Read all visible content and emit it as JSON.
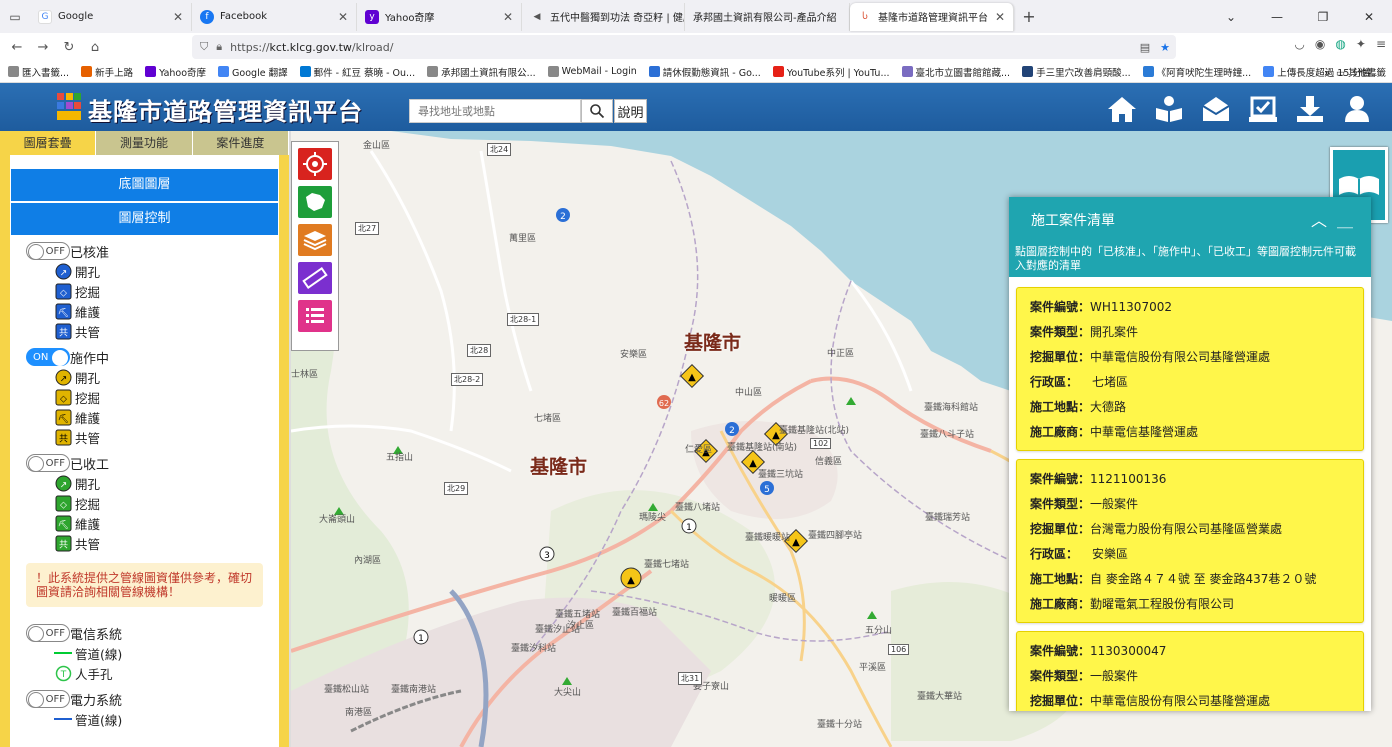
{
  "browser": {
    "tabs": [
      {
        "label": "Google",
        "color": "#4285f4",
        "glyph": "G"
      },
      {
        "label": "Facebook",
        "color": "#1877f2",
        "glyph": "f"
      },
      {
        "label": "Yahoo奇摩",
        "color": "#6001d2",
        "glyph": "y"
      },
      {
        "label": "五代中醫獨到功法 奇亞籽 | 健康",
        "color": "#777777",
        "glyph": "◀"
      },
      {
        "label": "承邦國土資訊有限公司-產品介紹",
        "color": "#cccccc",
        "glyph": ""
      },
      {
        "label": "基隆市道路管理資訊平台",
        "color": "#d94a2b",
        "glyph": "K"
      }
    ],
    "url_prefix": "https://",
    "url_host": "kct.klcg.gov.tw",
    "url_path": "/klroad/",
    "bookmarks": [
      {
        "label": "匯入書籤...",
        "color": "#888888"
      },
      {
        "label": "新手上路",
        "color": "#e66000"
      },
      {
        "label": "Yahoo奇摩",
        "color": "#6001d2"
      },
      {
        "label": "Google 翻譯",
        "color": "#4285f4"
      },
      {
        "label": "郵件 - 紅豆 蔡曉 - Ou...",
        "color": "#0078d4"
      },
      {
        "label": "承邦國土資訊有限公...",
        "color": "#888888"
      },
      {
        "label": "WebMail - Login",
        "color": "#888888"
      },
      {
        "label": "請休假勤態資訊 - Go...",
        "color": "#2b6fd6"
      },
      {
        "label": "YouTube系列 | YouTu...",
        "color": "#e62117"
      },
      {
        "label": "臺北市立圖書館館藏...",
        "color": "#7a6cc1"
      },
      {
        "label": "手三里穴改善肩頸酸...",
        "color": "#224477"
      },
      {
        "label": "《阿育吠陀生理時鐘...",
        "color": "#2b7bd6"
      },
      {
        "label": "上傳長度超過 15 分鐘...",
        "color": "#4285f4"
      }
    ],
    "bookmarks_more": "其他書籤"
  },
  "header": {
    "title": "基隆市道路管理資訊平台",
    "search_placeholder": "尋找地址或地點",
    "help_label": "說明"
  },
  "sidebar": {
    "tabs": [
      "圖層套疊",
      "測量功能",
      "案件進度"
    ],
    "active_tab": 0,
    "basemap_label": "底圖圖層",
    "layer_control_label": "圖層控制",
    "groups": [
      {
        "state": "OFF",
        "label": "已核准",
        "items": [
          "開孔",
          "挖掘",
          "維護",
          "共管"
        ],
        "color": "#1f5fd0"
      },
      {
        "state": "ON",
        "label": "施作中",
        "items": [
          "開孔",
          "挖掘",
          "維護",
          "共管"
        ],
        "color": "#e0b400"
      },
      {
        "state": "OFF",
        "label": "已收工",
        "items": [
          "開孔",
          "挖掘",
          "維護",
          "共管"
        ],
        "color": "#2ea52e"
      }
    ],
    "notice": "！此系統提供之管線圖資僅供參考，確切圖資請洽詢相關管線機構！",
    "telecom": {
      "state": "OFF",
      "label": "電信系統",
      "items": [
        "管道(線)",
        "人手孔"
      ],
      "item_glyph": "T"
    },
    "power": {
      "state": "OFF",
      "label": "電力系統",
      "items": [
        "管道(線)"
      ]
    }
  },
  "map": {
    "city_labels": [
      "基隆市",
      "基隆市"
    ],
    "districts": [
      "金山區",
      "萬里區",
      "安樂區",
      "中山區",
      "中正區",
      "七堵區",
      "信義區",
      "仁愛區",
      "暖暖區",
      "汐止區",
      "平溪區",
      "內湖區",
      "士林區",
      "南港區",
      "五分山",
      "大尖山",
      "五指山",
      "大崙頭山",
      "姜子寮山",
      "瑪陵尖"
    ],
    "stations": [
      "臺鐵基隆站(北站)",
      "臺鐵基隆站(南站)",
      "臺鐵三坑站",
      "臺鐵八堵站",
      "臺鐵七堵站",
      "臺鐵百福站",
      "臺鐵五堵站",
      "臺鐵汐止站",
      "臺鐵汐科站",
      "臺鐵暖暖站",
      "臺鐵四腳亭站",
      "臺鐵海科館站",
      "臺鐵八斗子站",
      "臺鐵瑞芳站",
      "臺鐵大華站",
      "臺鐵十分站",
      "臺鐵南港站",
      "臺鐵松山站"
    ],
    "roads": [
      "北24",
      "北27",
      "北28-1",
      "北28",
      "北28-2",
      "北29",
      "北31",
      "102",
      "106",
      "62",
      "2",
      "1",
      "3",
      "5"
    ]
  },
  "case_panel": {
    "title": "施工案件清單",
    "hint": "點圖層控制中的「已核准」、「施作中」、「已收工」等圖層控制元件可載入對應的清單",
    "field_labels": {
      "id": "案件編號：",
      "type": "案件類型：",
      "unit": "挖掘單位：",
      "district": "行政區：",
      "location": "施工地點：",
      "contractor": "施工廠商："
    },
    "cases": [
      {
        "id": "WH11307002",
        "type": "開孔案件",
        "unit": "中華電信股份有限公司基隆營運處",
        "district": "七堵區",
        "location": "大德路",
        "contractor": "中華電信基隆營運處"
      },
      {
        "id": "1121100136",
        "type": "一般案件",
        "unit": "台灣電力股份有限公司基隆區營業處",
        "district": "安樂區",
        "location": "自 麥金路４７４號 至 麥金路437巷２０號",
        "contractor": "勤曜電氣工程股份有限公司"
      },
      {
        "id": "1130300047",
        "type": "一般案件",
        "unit": "中華電信股份有限公司基隆營運處",
        "district": "",
        "location": "",
        "contractor": ""
      }
    ]
  },
  "colors": {
    "header_blue": "#1e5c9e",
    "panel_teal": "#1fa5b0",
    "card_yellow": "#fff64a",
    "sidebar_yellow": "#f6d448",
    "button_blue": "#0f7ee6"
  }
}
